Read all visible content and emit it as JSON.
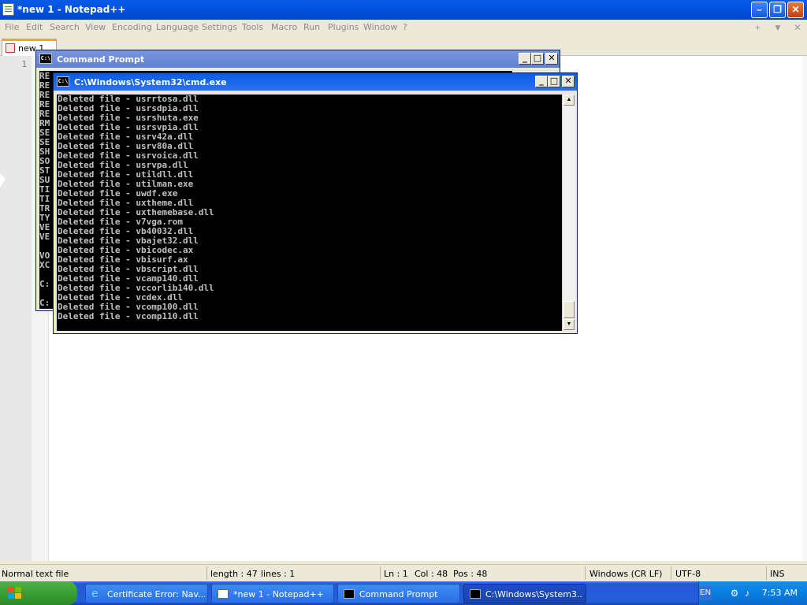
{
  "npp": {
    "title": "*new 1 - Notepad++",
    "menu": [
      "File",
      "Edit",
      "Search",
      "View",
      "Encoding",
      "Language",
      "Settings",
      "Tools",
      "Macro",
      "Run",
      "Plugins",
      "Window",
      "?"
    ],
    "menu_right": [
      "+",
      "▼",
      "✕"
    ],
    "tab_label": "new 1",
    "line_number": "1",
    "status": {
      "type": "Normal text file",
      "length": "length : 47",
      "lines": "lines : 1",
      "ln": "Ln : 1",
      "col": "Col : 48",
      "pos": "Pos : 48",
      "eol": "Windows (CR LF)",
      "encoding": "UTF-8",
      "mode": "INS"
    }
  },
  "console1": {
    "title": "Command Prompt",
    "icon_text": "C:\\",
    "lines": [
      "RE",
      "RE",
      "RE",
      "RE",
      "RE",
      "RM",
      "SE",
      "SE",
      "SH",
      "SO",
      "ST",
      "SU",
      "TI",
      "TI",
      "TR",
      "TY",
      "VE",
      "VE",
      "",
      "VO",
      "XC",
      "",
      "C:",
      "",
      "C:"
    ]
  },
  "console2": {
    "title": "C:\\Windows\\System32\\cmd.exe",
    "icon_text": "C:\\",
    "lines": [
      "Deleted file - usrrtosa.dll",
      "Deleted file - usrsdpia.dll",
      "Deleted file - usrshuta.exe",
      "Deleted file - usrsvpia.dll",
      "Deleted file - usrv42a.dll",
      "Deleted file - usrv80a.dll",
      "Deleted file - usrvoica.dll",
      "Deleted file - usrvpa.dll",
      "Deleted file - utildll.dll",
      "Deleted file - utilman.exe",
      "Deleted file - uwdf.exe",
      "Deleted file - uxtheme.dll",
      "Deleted file - uxthemebase.dll",
      "Deleted file - v7vga.rom",
      "Deleted file - vb40032.dll",
      "Deleted file - vbajet32.dll",
      "Deleted file - vbicodec.ax",
      "Deleted file - vbisurf.ax",
      "Deleted file - vbscript.dll",
      "Deleted file - vcamp140.dll",
      "Deleted file - vccorlib140.dll",
      "Deleted file - vcdex.dll",
      "Deleted file - vcomp100.dll",
      "Deleted file - vcomp110.dll"
    ]
  },
  "taskbar": {
    "start_label": "",
    "tasks": [
      {
        "label": "Certificate Error: Nav...",
        "icon": "ie-icon"
      },
      {
        "label": "*new 1 - Notepad++",
        "icon": "notepad-icon"
      },
      {
        "label": "Command Prompt",
        "icon": "cmd-icon"
      },
      {
        "label": "C:\\Windows\\System3...",
        "icon": "cmd-icon"
      }
    ],
    "lang": "EN",
    "time": "7:53 AM"
  },
  "colors": {
    "xp_blue": "#0054e3",
    "console_bg": "#000000",
    "console_fg": "#c0c0c0",
    "start_green": "#379f33"
  }
}
